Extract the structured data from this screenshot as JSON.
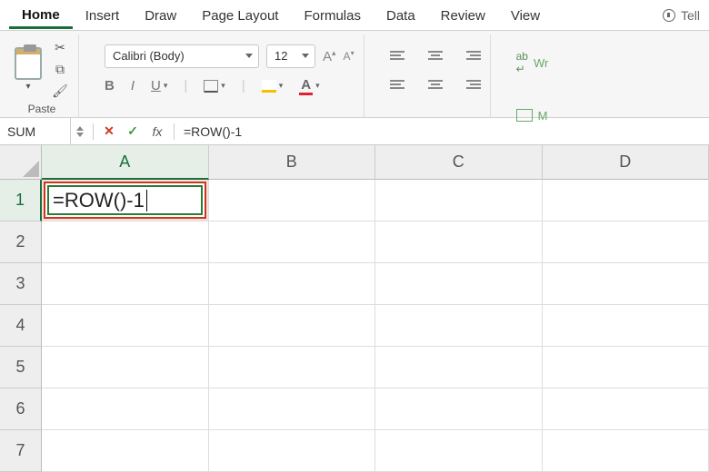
{
  "tabs": {
    "home": "Home",
    "insert": "Insert",
    "draw": "Draw",
    "page_layout": "Page Layout",
    "formulas": "Formulas",
    "data": "Data",
    "review": "Review",
    "view": "View",
    "tell": "Tell"
  },
  "ribbon": {
    "clipboard": {
      "paste_label": "Paste"
    },
    "font": {
      "name": "Calibri (Body)",
      "size": "12",
      "bold": "B",
      "italic": "I",
      "underline": "U",
      "font_color_letter": "A",
      "inc_marker": "A",
      "dec_marker": "A"
    },
    "right": {
      "wrap": "Wr",
      "merge": "M"
    }
  },
  "formula_bar": {
    "name_box": "SUM",
    "fx": "fx",
    "cancel_glyph": "✕",
    "enter_glyph": "✓",
    "formula": "=ROW()-1"
  },
  "grid": {
    "columns": [
      "A",
      "B",
      "C",
      "D"
    ],
    "rows": [
      "1",
      "2",
      "3",
      "4",
      "5",
      "6",
      "7"
    ],
    "a1_value": "=ROW()-1"
  }
}
